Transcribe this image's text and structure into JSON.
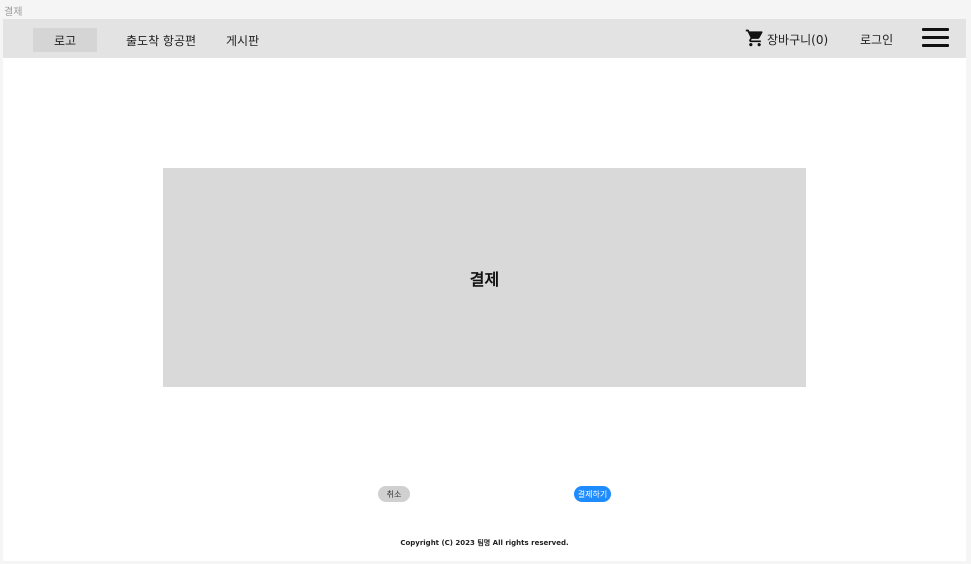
{
  "page": {
    "label": "결제"
  },
  "navbar": {
    "logo": "로고",
    "links": [
      "출도착 항공편",
      "게시판"
    ],
    "cart_label": "장바구니(0)",
    "login_label": "로그인"
  },
  "main": {
    "title": "결제"
  },
  "actions": {
    "cancel_label": "취소",
    "pay_label": "결제하기"
  },
  "footer": {
    "copyright": "Copyright (C) 2023 팀명 All rights reserved."
  },
  "colors": {
    "accent": "#1e8bff",
    "navbar": "#e3e3e3",
    "panel": "#d9d9d9"
  },
  "icons": [
    "cart-icon",
    "hamburger-menu-icon"
  ]
}
